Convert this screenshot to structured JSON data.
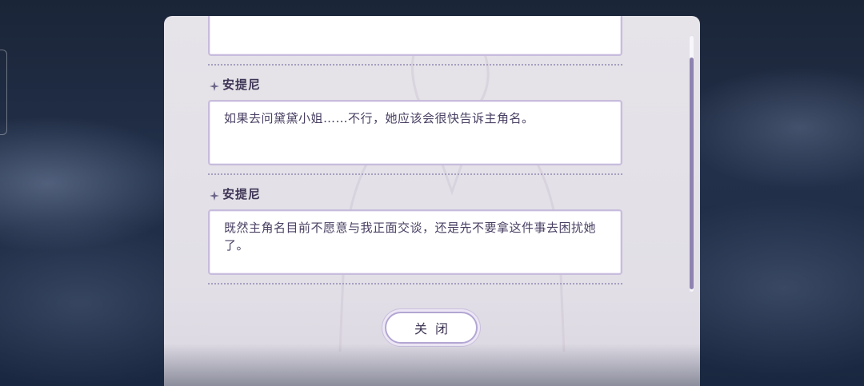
{
  "dialog_log": {
    "entries": [
      {
        "speaker": "安提尼",
        "text": "如果去问黛黛小姐……不行，她应该会很快告诉主角名。"
      },
      {
        "speaker": "安提尼",
        "text": "既然主角名目前不愿意与我正面交谈，还是先不要拿这件事去困扰她了。"
      }
    ],
    "scroll_position": 0.9
  },
  "close_button": {
    "label": "关闭"
  },
  "icons": {
    "speaker_marker": "sparkle-star-icon"
  },
  "colors": {
    "panel": "#e4e1e8",
    "box_border": "#c7bcdc",
    "text": "#4a4063",
    "scroll_thumb": "#8e83b0"
  }
}
